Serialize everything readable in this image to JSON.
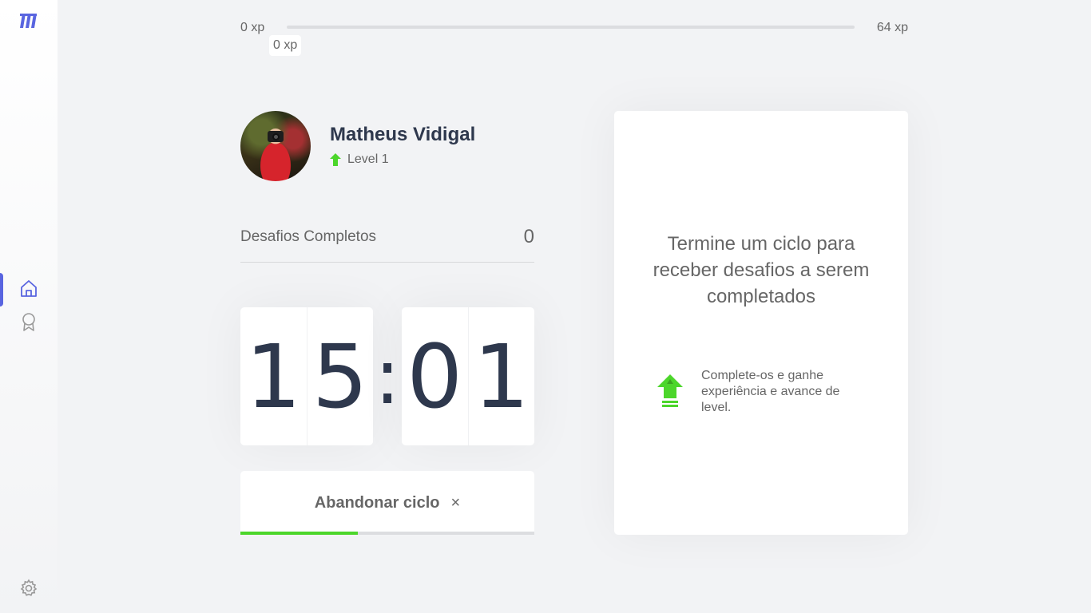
{
  "sidebar": {
    "logo": "move-it-logo-icon",
    "nav": [
      {
        "icon": "home-icon",
        "active": true
      },
      {
        "icon": "award-icon",
        "active": false
      }
    ],
    "settings_icon": "gear-icon",
    "accent": "#5965e0"
  },
  "xp": {
    "min_label": "0 xp",
    "max_label": "64 xp",
    "current_label": "0 xp",
    "progress_fraction": 0.0
  },
  "profile": {
    "name": "Matheus Vidigal",
    "level_label": "Level 1",
    "level_icon": "level-up-arrow-icon"
  },
  "completed": {
    "label": "Desafios Completos",
    "count": "0"
  },
  "countdown": {
    "minute_left": "1",
    "minute_right": "5",
    "separator": ":",
    "second_left": "0",
    "second_right": "1"
  },
  "cycle_button": {
    "label": "Abandonar ciclo",
    "icon_glyph": "×",
    "progress_fraction": 0.4
  },
  "challenge_box": {
    "title": "Termine um ciclo para receber desafios a serem completados",
    "hint": "Complete-os e ganhe experiência e avance de level.",
    "hint_icon": "level-up-arrow-icon"
  },
  "colors": {
    "green": "#4cd62b",
    "title": "#2e384d",
    "text": "#666666",
    "background": "#f2f3f5"
  }
}
